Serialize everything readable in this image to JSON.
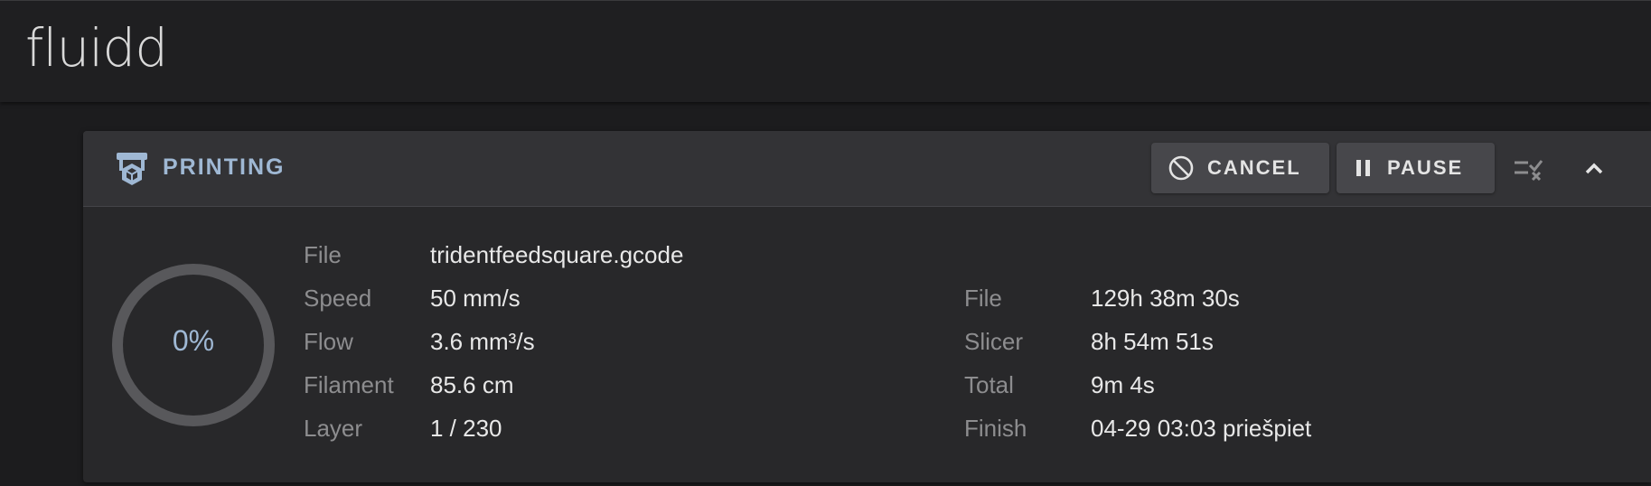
{
  "app": {
    "logo": "fluidd"
  },
  "status_card": {
    "title": "PRINTING",
    "buttons": {
      "cancel": "CANCEL",
      "pause": "PAUSE"
    },
    "progress": {
      "label": "0%",
      "fraction": 0
    },
    "info": [
      {
        "label": "File",
        "value": "tridentfeedsquare.gcode"
      },
      {
        "label": "Speed",
        "value": "50 mm/s"
      },
      {
        "label": "Flow",
        "value": "3.6 mm³/s"
      },
      {
        "label": "Filament",
        "value": "85.6 cm"
      },
      {
        "label": "Layer",
        "value": "1 / 230"
      }
    ],
    "times": [
      {
        "label": "File",
        "value": "129h 38m 30s"
      },
      {
        "label": "Slicer",
        "value": "8h 54m 51s"
      },
      {
        "label": "Total",
        "value": "9m 4s"
      },
      {
        "label": "Finish",
        "value": "04-29 03:03 priešpiet"
      }
    ]
  },
  "icons": [
    "printer-icon",
    "cancel-icon",
    "pause-icon",
    "clear-exclude-icon",
    "chevron-up-icon"
  ],
  "colors": {
    "accent": "#9fb8d4",
    "background": "#1c1c1e",
    "card": "#28282a",
    "header": "#333336"
  }
}
